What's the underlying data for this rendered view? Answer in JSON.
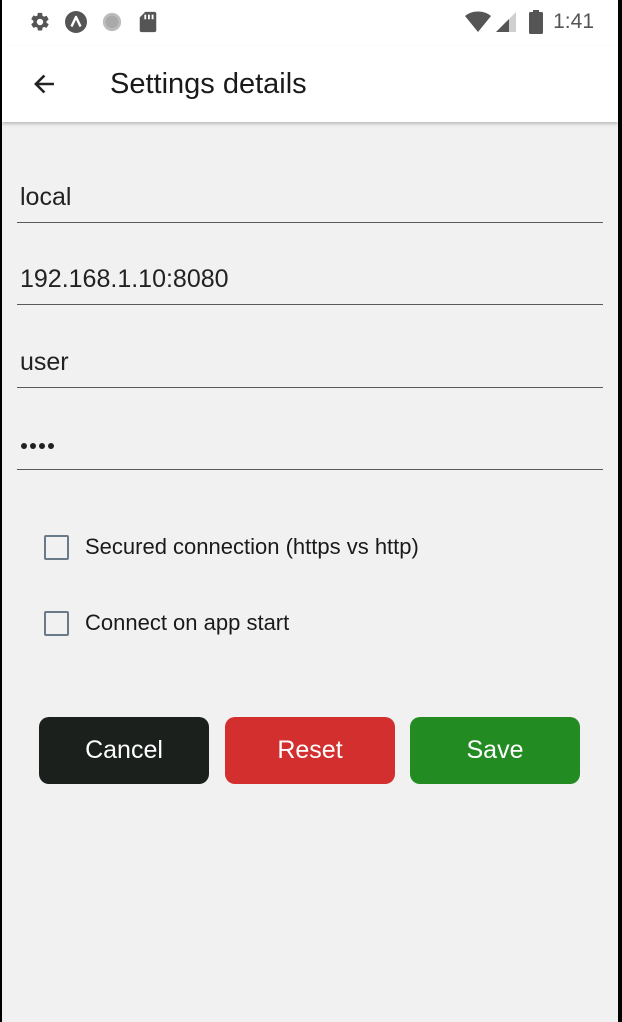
{
  "status_bar": {
    "left_icons": [
      "settings-gear-icon",
      "app-a-icon",
      "circle-icon",
      "sd-card-icon"
    ],
    "right_icons": [
      "wifi-icon",
      "signal-icon",
      "battery-icon"
    ],
    "time": "1:41"
  },
  "app_bar": {
    "back_icon": "arrow-back-icon",
    "title": "Settings details"
  },
  "form": {
    "name_value": "local",
    "address_value": "192.168.1.10:8080",
    "user_value": "user",
    "password_length": 4
  },
  "options": {
    "secured_label": "Secured connection (https vs http)",
    "secured_checked": false,
    "autoconnect_label": "Connect on app start",
    "autoconnect_checked": false
  },
  "buttons": {
    "cancel_label": "Cancel",
    "reset_label": "Reset",
    "save_label": "Save"
  },
  "colors": {
    "cancel": "#1b201d",
    "reset": "#d32f2f",
    "save": "#228b22"
  }
}
